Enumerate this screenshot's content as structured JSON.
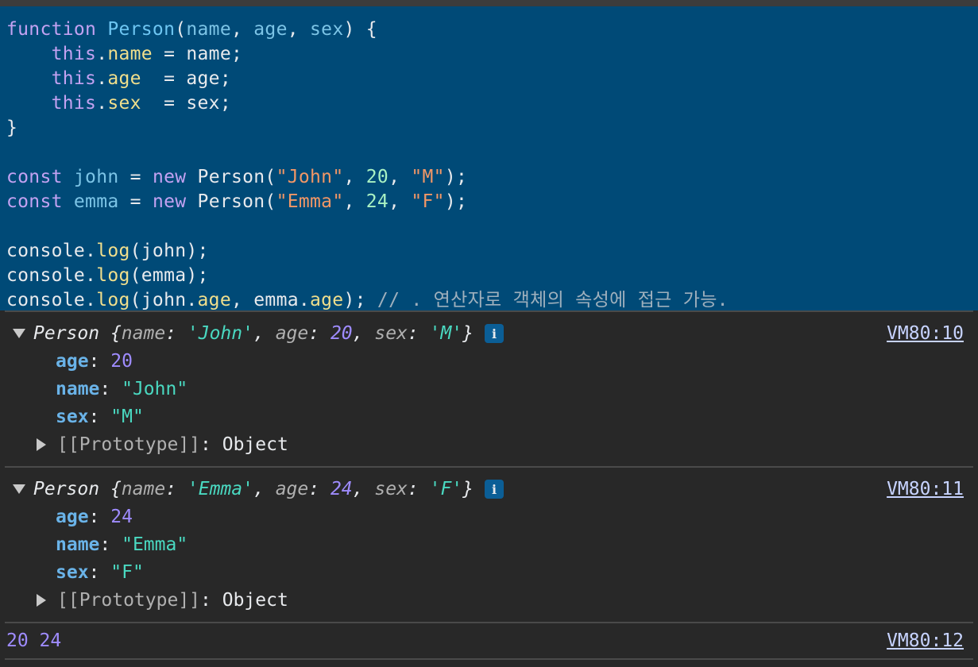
{
  "editor": {
    "lines": [
      [
        {
          "t": "function",
          "c": "kw"
        },
        {
          "t": " "
        },
        {
          "t": "Person",
          "c": "fn"
        },
        {
          "t": "("
        },
        {
          "t": "name",
          "c": "param"
        },
        {
          "t": ", "
        },
        {
          "t": "age",
          "c": "param"
        },
        {
          "t": ", "
        },
        {
          "t": "sex",
          "c": "param"
        },
        {
          "t": ") {"
        }
      ],
      [
        {
          "t": "    "
        },
        {
          "t": "this",
          "c": "kw"
        },
        {
          "t": "."
        },
        {
          "t": "name",
          "c": "prop"
        },
        {
          "t": " = name;"
        }
      ],
      [
        {
          "t": "    "
        },
        {
          "t": "this",
          "c": "kw"
        },
        {
          "t": "."
        },
        {
          "t": "age",
          "c": "prop"
        },
        {
          "t": "  = age;"
        }
      ],
      [
        {
          "t": "    "
        },
        {
          "t": "this",
          "c": "kw"
        },
        {
          "t": "."
        },
        {
          "t": "sex",
          "c": "prop"
        },
        {
          "t": "  = sex;"
        }
      ],
      [
        {
          "t": "}"
        }
      ],
      [
        {
          "t": ""
        }
      ],
      [
        {
          "t": "const",
          "c": "kw"
        },
        {
          "t": " "
        },
        {
          "t": "john",
          "c": "param"
        },
        {
          "t": " = "
        },
        {
          "t": "new",
          "c": "kw"
        },
        {
          "t": " Person("
        },
        {
          "t": "\"John\"",
          "c": "str"
        },
        {
          "t": ", "
        },
        {
          "t": "20",
          "c": "num"
        },
        {
          "t": ", "
        },
        {
          "t": "\"M\"",
          "c": "str"
        },
        {
          "t": ");"
        }
      ],
      [
        {
          "t": "const",
          "c": "kw"
        },
        {
          "t": " "
        },
        {
          "t": "emma",
          "c": "param"
        },
        {
          "t": " = "
        },
        {
          "t": "new",
          "c": "kw"
        },
        {
          "t": " Person("
        },
        {
          "t": "\"Emma\"",
          "c": "str"
        },
        {
          "t": ", "
        },
        {
          "t": "24",
          "c": "num"
        },
        {
          "t": ", "
        },
        {
          "t": "\"F\"",
          "c": "str"
        },
        {
          "t": ");"
        }
      ],
      [
        {
          "t": ""
        }
      ],
      [
        {
          "t": "console."
        },
        {
          "t": "log",
          "c": "prop"
        },
        {
          "t": "(john);"
        }
      ],
      [
        {
          "t": "console."
        },
        {
          "t": "log",
          "c": "prop"
        },
        {
          "t": "(emma);"
        }
      ],
      [
        {
          "t": "console."
        },
        {
          "t": "log",
          "c": "prop"
        },
        {
          "t": "(john."
        },
        {
          "t": "age",
          "c": "prop"
        },
        {
          "t": ", emma."
        },
        {
          "t": "age",
          "c": "prop"
        },
        {
          "t": "); "
        },
        {
          "t": "// . 연산자로 객체의 속성에 접근 가능.",
          "c": "cmt"
        }
      ]
    ]
  },
  "console": {
    "entries": [
      {
        "class_name": "Person",
        "preview": {
          "name_key": "name",
          "name_val": "'John'",
          "age_key": "age",
          "age_val": "20",
          "sex_key": "sex",
          "sex_val": "'M'"
        },
        "info_icon": "i",
        "source": "VM80:10",
        "props": [
          {
            "key": "age",
            "value": "20",
            "type": "num"
          },
          {
            "key": "name",
            "value": "\"John\"",
            "type": "str"
          },
          {
            "key": "sex",
            "value": "\"M\"",
            "type": "str"
          }
        ],
        "proto_key": "[[Prototype]]",
        "proto_val": "Object"
      },
      {
        "class_name": "Person",
        "preview": {
          "name_key": "name",
          "name_val": "'Emma'",
          "age_key": "age",
          "age_val": "24",
          "sex_key": "sex",
          "sex_val": "'F'"
        },
        "info_icon": "i",
        "source": "VM80:11",
        "props": [
          {
            "key": "age",
            "value": "24",
            "type": "num"
          },
          {
            "key": "name",
            "value": "\"Emma\"",
            "type": "str"
          },
          {
            "key": "sex",
            "value": "\"F\"",
            "type": "str"
          }
        ],
        "proto_key": "[[Prototype]]",
        "proto_val": "Object"
      }
    ],
    "result": {
      "text": "20 24",
      "source": "VM80:12"
    }
  },
  "colors": {
    "editor_bg": "#004a77",
    "console_bg": "#282828"
  }
}
